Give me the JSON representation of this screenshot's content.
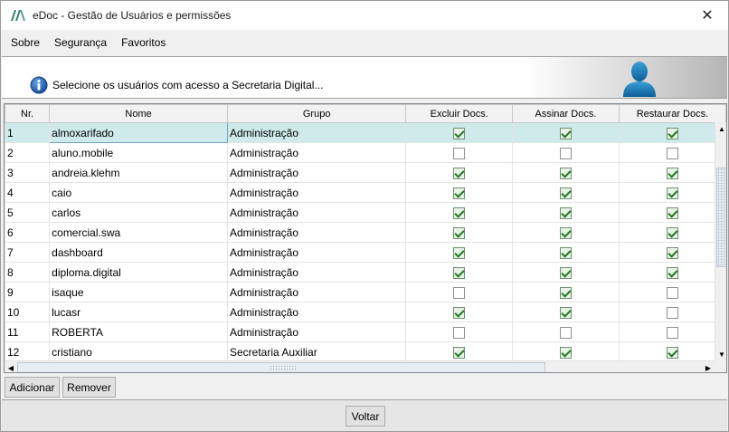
{
  "window": {
    "title": "eDoc - Gestão de Usuários e permissões",
    "close_glyph": "✕"
  },
  "menu": [
    {
      "label": "Sobre"
    },
    {
      "label": "Segurança"
    },
    {
      "label": "Favoritos"
    }
  ],
  "header": {
    "message": "Selecione os usuários com acesso a Secretaria Digital..."
  },
  "table": {
    "columns": [
      "Nr.",
      "Nome",
      "Grupo",
      "Excluir Docs.",
      "Assinar Docs.",
      "Restaurar Docs."
    ],
    "rows": [
      {
        "nr": "1",
        "nome": "almoxarifado",
        "grupo": "Administração",
        "excluir": true,
        "assinar": true,
        "restaurar": true,
        "selected": true
      },
      {
        "nr": "2",
        "nome": "aluno.mobile",
        "grupo": "Administração",
        "excluir": false,
        "assinar": false,
        "restaurar": false
      },
      {
        "nr": "3",
        "nome": "andreia.klehm",
        "grupo": "Administração",
        "excluir": true,
        "assinar": true,
        "restaurar": true
      },
      {
        "nr": "4",
        "nome": "caio",
        "grupo": "Administração",
        "excluir": true,
        "assinar": true,
        "restaurar": true
      },
      {
        "nr": "5",
        "nome": "carlos",
        "grupo": "Administração",
        "excluir": true,
        "assinar": true,
        "restaurar": true
      },
      {
        "nr": "6",
        "nome": "comercial.swa",
        "grupo": "Administração",
        "excluir": true,
        "assinar": true,
        "restaurar": true
      },
      {
        "nr": "7",
        "nome": "dashboard",
        "grupo": "Administração",
        "excluir": true,
        "assinar": true,
        "restaurar": true
      },
      {
        "nr": "8",
        "nome": "diploma.digital",
        "grupo": "Administração",
        "excluir": true,
        "assinar": true,
        "restaurar": true
      },
      {
        "nr": "9",
        "nome": "isaque",
        "grupo": "Administração",
        "excluir": false,
        "assinar": true,
        "restaurar": false
      },
      {
        "nr": "10",
        "nome": "lucasr",
        "grupo": "Administração",
        "excluir": true,
        "assinar": true,
        "restaurar": false
      },
      {
        "nr": "11",
        "nome": "ROBERTA",
        "grupo": "Administração",
        "excluir": false,
        "assinar": false,
        "restaurar": false
      },
      {
        "nr": "12",
        "nome": "cristiano",
        "grupo": "Secretaria Auxiliar",
        "excluir": true,
        "assinar": true,
        "restaurar": true
      }
    ]
  },
  "buttons": {
    "adicionar": "Adicionar",
    "remover": "Remover",
    "voltar": "Voltar"
  },
  "colors": {
    "accent": "#1e6fb8",
    "selected_row": "#cfeaea",
    "check": "#1f7a1f"
  }
}
